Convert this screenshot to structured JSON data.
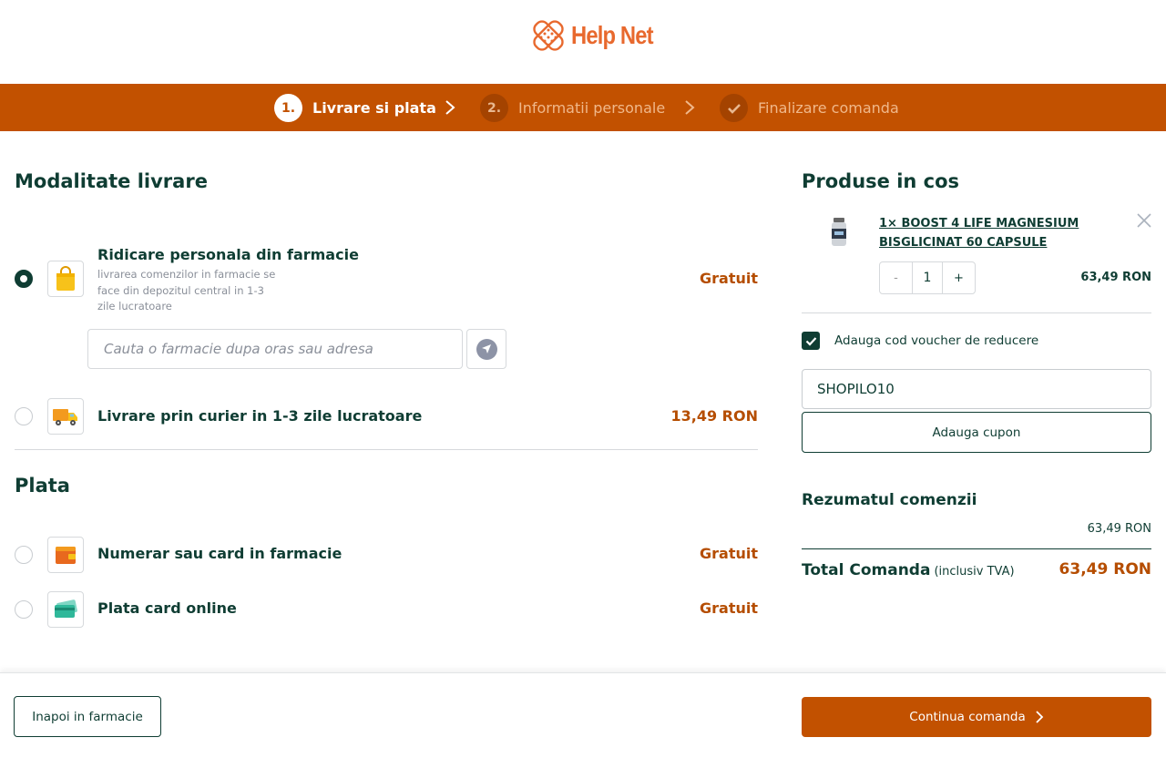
{
  "header": {
    "logo_text": "Help Net",
    "brand_color": "#e8692e"
  },
  "steps": [
    {
      "number": "1.",
      "label": "Livrare si plata",
      "state": "active"
    },
    {
      "number": "2.",
      "label": "Informatii personale",
      "state": "inactive"
    },
    {
      "number": "check-icon",
      "label": "Finalizare comanda",
      "state": "inactive"
    }
  ],
  "delivery": {
    "title": "Modalitate livrare",
    "options": [
      {
        "title": "Ridicare personala din farmacie",
        "description": "livrarea comenzilor in farmacie se face din depozitul central in 1-3 zile lucratoare",
        "price": "Gratuit",
        "selected": true,
        "icon": "shopping-bag-icon"
      },
      {
        "title": "Livrare prin curier in 1-3 zile lucratoare",
        "price": "13,49 RON",
        "selected": false,
        "icon": "delivery-truck-icon"
      }
    ],
    "search_placeholder": "Cauta o farmacie dupa oras sau adresa"
  },
  "payment": {
    "title": "Plata",
    "options": [
      {
        "title": "Numerar sau card in farmacie",
        "price": "Gratuit",
        "selected": false,
        "icon": "wallet-icon"
      },
      {
        "title": "Plata card online",
        "price": "Gratuit",
        "selected": false,
        "icon": "credit-card-icon"
      }
    ]
  },
  "cart": {
    "title": "Produse in cos",
    "product": {
      "name": "1× BOOST 4 LIFE MAGNESIUM BISGLICINAT 60 CAPSULE",
      "quantity": "1",
      "minus": "-",
      "plus": "+",
      "price": "63,49 RON"
    },
    "voucher_checkbox_label": "Adauga cod voucher de reducere",
    "voucher_checked": true,
    "voucher_value": "SHOPILO10",
    "coupon_button": "Adauga cupon"
  },
  "summary": {
    "title": "Rezumatul comenzii",
    "subtotal": "63,49 RON",
    "total_label": "Total Comanda",
    "total_note": "(inclusiv TVA)",
    "total_value": "63,49 RON"
  },
  "footer": {
    "back_button": "Inapoi in farmacie",
    "continue_button": "Continua comanda"
  },
  "colors": {
    "primary_orange": "#c25100",
    "dark_green": "#0f3d33",
    "price_orange": "#b54d00"
  }
}
